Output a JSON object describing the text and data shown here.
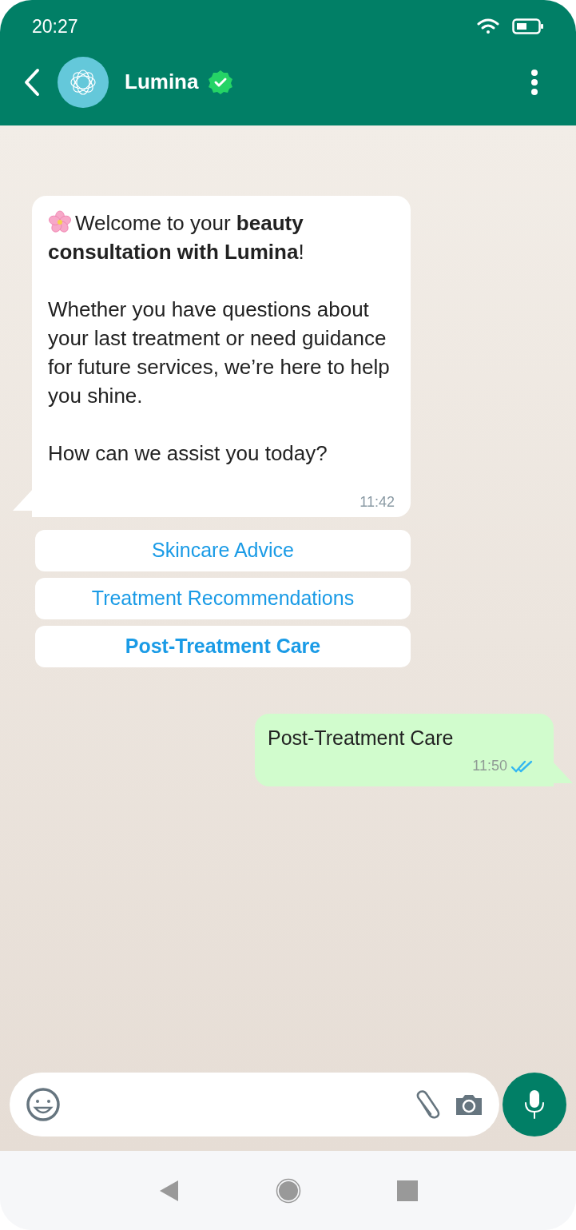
{
  "status_bar": {
    "time": "20:27"
  },
  "header": {
    "name": "Lumina",
    "verified": true
  },
  "messages": [
    {
      "kind": "incoming",
      "paragraphs": [
        "Welcome to your **beauty consultation with Lumina**!",
        "Whether you have questions about your last treatment or need guidance for future services, we’re here to help you shine.",
        "How can we assist you today?"
      ],
      "time": "11:42",
      "quick_replies": [
        {
          "label": "Skincare Advice",
          "selected": false
        },
        {
          "label": "Treatment Recommendations",
          "selected": false
        },
        {
          "label": "Post-Treatment Care",
          "selected": true
        }
      ]
    },
    {
      "kind": "outgoing",
      "paragraphs": [
        "Post-Treatment Care"
      ],
      "time": "11:50",
      "read": true
    }
  ]
}
